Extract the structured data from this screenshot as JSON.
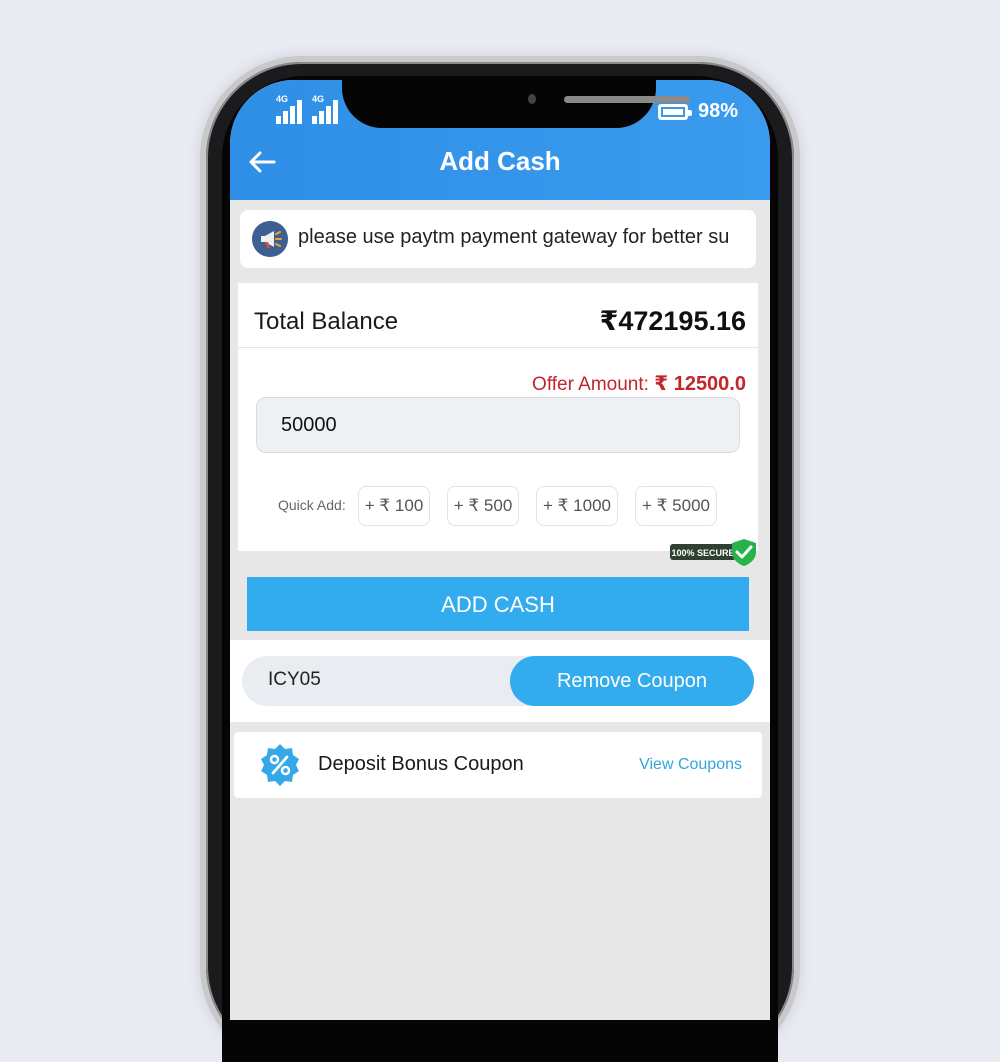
{
  "status_bar": {
    "signal_1_label": "4G",
    "signal_2_label": "4G",
    "battery_percent": "98%",
    "battery_level": 0.98
  },
  "header": {
    "title": "Add Cash",
    "back_icon": "back-arrow-icon"
  },
  "marquee": {
    "icon": "megaphone-icon",
    "text": "please use paytm payment gateway for better su"
  },
  "balance": {
    "label": "Total Balance",
    "value": "₹472195.16"
  },
  "offer": {
    "label": "Offer Amount:",
    "amount": "₹ 12500.0"
  },
  "amount_input": {
    "value": "50000"
  },
  "quick_add": {
    "label": "Quick Add:",
    "chips": [
      "+ ₹ 100",
      "+ ₹ 500",
      "+ ₹ 1000",
      "+ ₹ 5000"
    ]
  },
  "secure_badge": {
    "text": "100% SECURE"
  },
  "add_cash_button": "ADD CASH",
  "coupon": {
    "code": "ICY05",
    "remove_label": "Remove Coupon"
  },
  "bonus": {
    "icon": "percent-badge-icon",
    "label": "Deposit Bonus Coupon",
    "link": "View Coupons"
  },
  "colors": {
    "header": "#2f8fe6",
    "primary_button": "#33acef",
    "offer_red": "#c0262b",
    "link_blue": "#33a6de",
    "background": "#e9ebf3"
  }
}
